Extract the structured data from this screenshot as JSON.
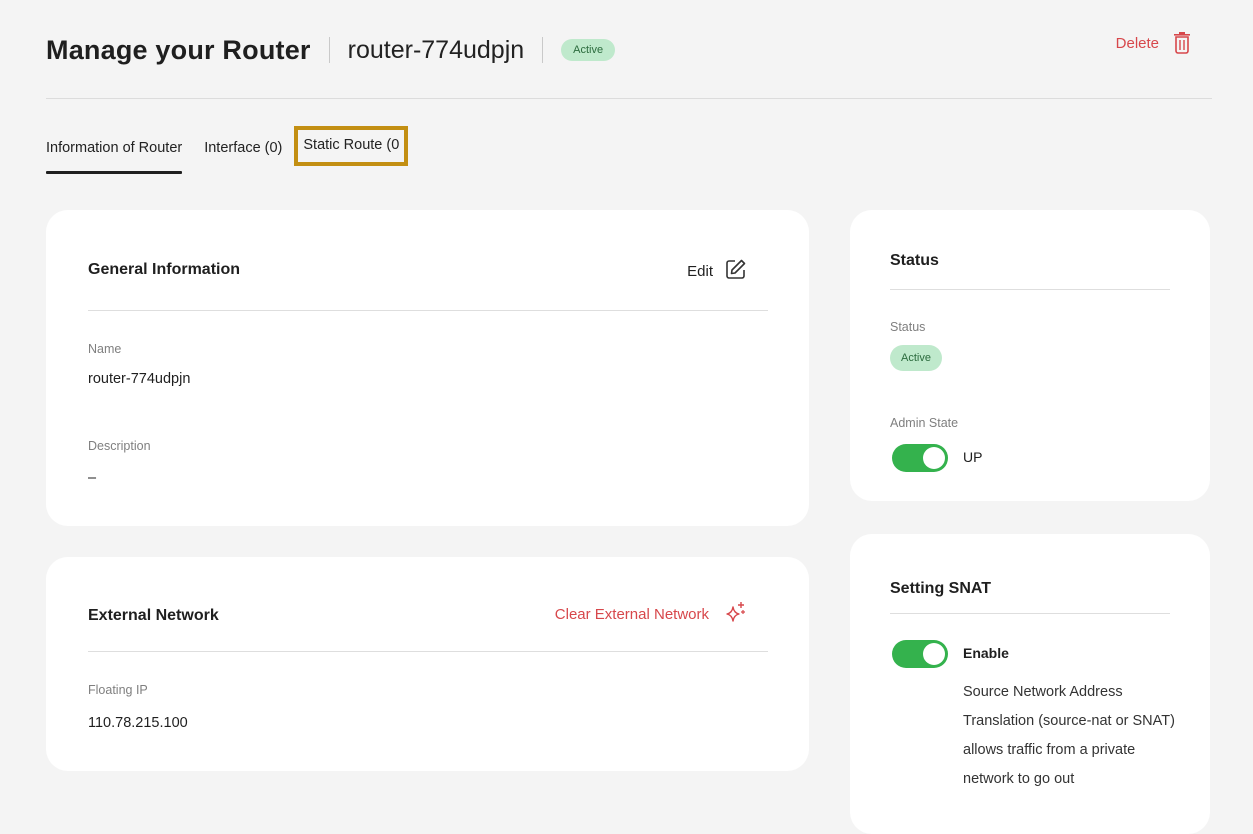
{
  "header": {
    "title": "Manage your Router",
    "router_name": "router-774udpjn",
    "status_badge": "Active",
    "delete_label": "Delete"
  },
  "tabs": [
    {
      "label": "Information of Router",
      "active": true
    },
    {
      "label": "Interface (0)",
      "active": false
    },
    {
      "label": "Static Route (0",
      "active": false
    }
  ],
  "general": {
    "title": "General Information",
    "edit_label": "Edit",
    "name_label": "Name",
    "name_value": "router-774udpjn",
    "description_label": "Description",
    "description_value": "–"
  },
  "external": {
    "title": "External Network",
    "clear_label": "Clear External Network",
    "floating_ip_label": "Floating IP",
    "floating_ip_value": "110.78.215.100"
  },
  "status": {
    "title": "Status",
    "status_label": "Status",
    "status_value": "Active",
    "admin_state_label": "Admin State",
    "admin_state_value": "UP"
  },
  "snat": {
    "title": "Setting SNAT",
    "enable_label": "Enable",
    "description": "Source Network Address Translation (source-nat or SNAT) allows traffic from a private network to go out"
  },
  "colors": {
    "accent_red": "#d7474b",
    "toggle_green": "#34b24d",
    "badge_bg": "#bfe9cc",
    "highlight": "#c38f12"
  }
}
